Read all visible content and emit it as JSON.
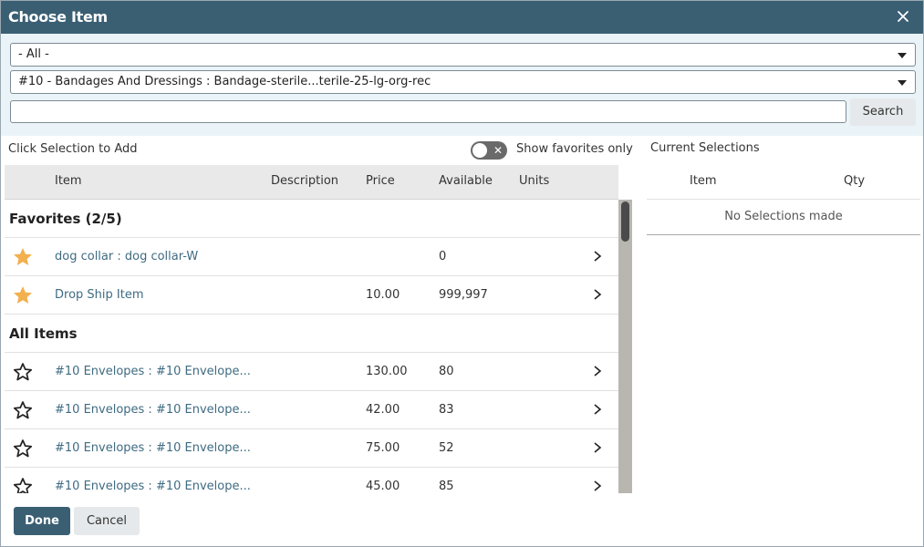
{
  "dialog": {
    "title": "Choose Item",
    "close_icon": "close-icon",
    "title_bar_color": "#3a5f73"
  },
  "filters": {
    "category_select": "- All -",
    "item_select": "#10 - Bandages And Dressings : Bandage-sterile...terile-25-lg-org-rec",
    "search_value": "",
    "search_button": "Search"
  },
  "list": {
    "instruction": "Click Selection to Add",
    "favorites_toggle_label": "Show favorites only",
    "favorites_toggle_on": false,
    "columns": [
      "Item",
      "Description",
      "Price",
      "Available",
      "Units"
    ],
    "favorites_header": "Favorites (2/5)",
    "favorites": [
      {
        "name": "dog collar : dog collar-W",
        "description": "",
        "price": "",
        "available": "0",
        "units": "",
        "favorite": true
      },
      {
        "name": "Drop Ship Item",
        "description": "",
        "price": "10.00",
        "available": "999,997",
        "units": "",
        "favorite": true
      }
    ],
    "all_header": "All Items",
    "all_items": [
      {
        "name": "#10 Envelopes : #10 Envelope...",
        "description": "",
        "price": "130.00",
        "available": "80",
        "units": "",
        "favorite": false
      },
      {
        "name": "#10 Envelopes : #10 Envelope...",
        "description": "",
        "price": "42.00",
        "available": "83",
        "units": "",
        "favorite": false
      },
      {
        "name": "#10 Envelopes : #10 Envelope...",
        "description": "",
        "price": "75.00",
        "available": "52",
        "units": "",
        "favorite": false
      },
      {
        "name": "#10 Envelopes : #10 Envelope...",
        "description": "",
        "price": "45.00",
        "available": "85",
        "units": "",
        "favorite": false
      }
    ],
    "star_color": "#f2b04e"
  },
  "current": {
    "title": "Current Selections",
    "columns": [
      "Item",
      "Qty"
    ],
    "empty_message": "No Selections made"
  },
  "footer": {
    "done": "Done",
    "cancel": "Cancel"
  }
}
